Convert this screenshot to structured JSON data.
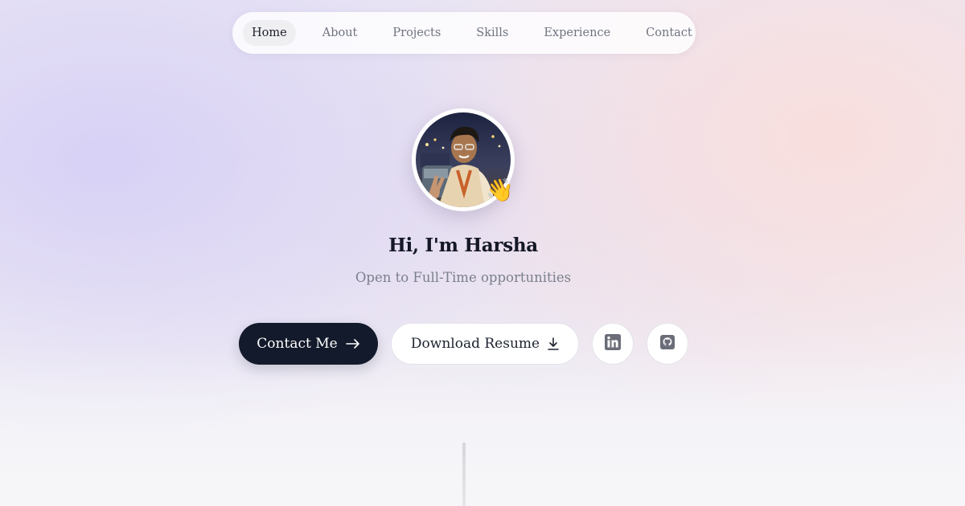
{
  "nav": {
    "items": [
      {
        "label": "Home",
        "active": true
      },
      {
        "label": "About",
        "active": false
      },
      {
        "label": "Projects",
        "active": false
      },
      {
        "label": "Skills",
        "active": false
      },
      {
        "label": "Experience",
        "active": false
      },
      {
        "label": "Contact",
        "active": false
      }
    ]
  },
  "hero": {
    "wave_emoji": "👋",
    "title": "Hi, I'm Harsha",
    "subtitle": "Open to Full-Time opportunities",
    "contact_button": {
      "label": "Contact Me",
      "icon": "arrow-right-icon"
    },
    "resume_button": {
      "label": "Download Resume",
      "icon": "download-icon"
    },
    "social": [
      {
        "name": "LinkedIn",
        "icon": "linkedin-icon"
      },
      {
        "name": "GitHub",
        "icon": "github-icon"
      }
    ]
  },
  "colors": {
    "primary_button": "#131a2b",
    "text_dark": "#141726",
    "text_muted": "#7b7f8c",
    "background_left": "#d6d0f6",
    "background_right": "#fadedc"
  }
}
